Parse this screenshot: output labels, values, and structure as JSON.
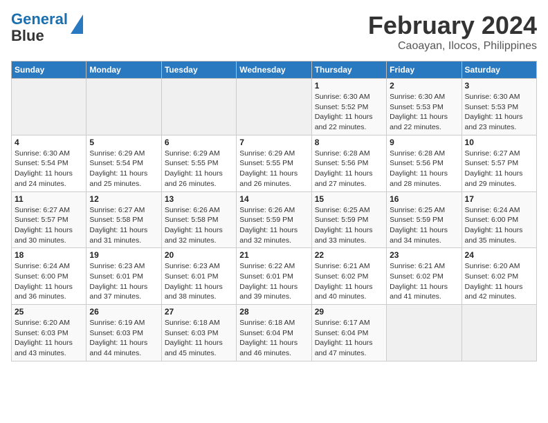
{
  "header": {
    "logo_line1": "General",
    "logo_line2": "Blue",
    "title": "February 2024",
    "subtitle": "Caoayan, Ilocos, Philippines"
  },
  "calendar": {
    "headers": [
      "Sunday",
      "Monday",
      "Tuesday",
      "Wednesday",
      "Thursday",
      "Friday",
      "Saturday"
    ],
    "weeks": [
      [
        {
          "day": "",
          "info": ""
        },
        {
          "day": "",
          "info": ""
        },
        {
          "day": "",
          "info": ""
        },
        {
          "day": "",
          "info": ""
        },
        {
          "day": "1",
          "info": "Sunrise: 6:30 AM\nSunset: 5:52 PM\nDaylight: 11 hours and 22 minutes."
        },
        {
          "day": "2",
          "info": "Sunrise: 6:30 AM\nSunset: 5:53 PM\nDaylight: 11 hours and 22 minutes."
        },
        {
          "day": "3",
          "info": "Sunrise: 6:30 AM\nSunset: 5:53 PM\nDaylight: 11 hours and 23 minutes."
        }
      ],
      [
        {
          "day": "4",
          "info": "Sunrise: 6:30 AM\nSunset: 5:54 PM\nDaylight: 11 hours and 24 minutes."
        },
        {
          "day": "5",
          "info": "Sunrise: 6:29 AM\nSunset: 5:54 PM\nDaylight: 11 hours and 25 minutes."
        },
        {
          "day": "6",
          "info": "Sunrise: 6:29 AM\nSunset: 5:55 PM\nDaylight: 11 hours and 26 minutes."
        },
        {
          "day": "7",
          "info": "Sunrise: 6:29 AM\nSunset: 5:55 PM\nDaylight: 11 hours and 26 minutes."
        },
        {
          "day": "8",
          "info": "Sunrise: 6:28 AM\nSunset: 5:56 PM\nDaylight: 11 hours and 27 minutes."
        },
        {
          "day": "9",
          "info": "Sunrise: 6:28 AM\nSunset: 5:56 PM\nDaylight: 11 hours and 28 minutes."
        },
        {
          "day": "10",
          "info": "Sunrise: 6:27 AM\nSunset: 5:57 PM\nDaylight: 11 hours and 29 minutes."
        }
      ],
      [
        {
          "day": "11",
          "info": "Sunrise: 6:27 AM\nSunset: 5:57 PM\nDaylight: 11 hours and 30 minutes."
        },
        {
          "day": "12",
          "info": "Sunrise: 6:27 AM\nSunset: 5:58 PM\nDaylight: 11 hours and 31 minutes."
        },
        {
          "day": "13",
          "info": "Sunrise: 6:26 AM\nSunset: 5:58 PM\nDaylight: 11 hours and 32 minutes."
        },
        {
          "day": "14",
          "info": "Sunrise: 6:26 AM\nSunset: 5:59 PM\nDaylight: 11 hours and 32 minutes."
        },
        {
          "day": "15",
          "info": "Sunrise: 6:25 AM\nSunset: 5:59 PM\nDaylight: 11 hours and 33 minutes."
        },
        {
          "day": "16",
          "info": "Sunrise: 6:25 AM\nSunset: 5:59 PM\nDaylight: 11 hours and 34 minutes."
        },
        {
          "day": "17",
          "info": "Sunrise: 6:24 AM\nSunset: 6:00 PM\nDaylight: 11 hours and 35 minutes."
        }
      ],
      [
        {
          "day": "18",
          "info": "Sunrise: 6:24 AM\nSunset: 6:00 PM\nDaylight: 11 hours and 36 minutes."
        },
        {
          "day": "19",
          "info": "Sunrise: 6:23 AM\nSunset: 6:01 PM\nDaylight: 11 hours and 37 minutes."
        },
        {
          "day": "20",
          "info": "Sunrise: 6:23 AM\nSunset: 6:01 PM\nDaylight: 11 hours and 38 minutes."
        },
        {
          "day": "21",
          "info": "Sunrise: 6:22 AM\nSunset: 6:01 PM\nDaylight: 11 hours and 39 minutes."
        },
        {
          "day": "22",
          "info": "Sunrise: 6:21 AM\nSunset: 6:02 PM\nDaylight: 11 hours and 40 minutes."
        },
        {
          "day": "23",
          "info": "Sunrise: 6:21 AM\nSunset: 6:02 PM\nDaylight: 11 hours and 41 minutes."
        },
        {
          "day": "24",
          "info": "Sunrise: 6:20 AM\nSunset: 6:02 PM\nDaylight: 11 hours and 42 minutes."
        }
      ],
      [
        {
          "day": "25",
          "info": "Sunrise: 6:20 AM\nSunset: 6:03 PM\nDaylight: 11 hours and 43 minutes."
        },
        {
          "day": "26",
          "info": "Sunrise: 6:19 AM\nSunset: 6:03 PM\nDaylight: 11 hours and 44 minutes."
        },
        {
          "day": "27",
          "info": "Sunrise: 6:18 AM\nSunset: 6:03 PM\nDaylight: 11 hours and 45 minutes."
        },
        {
          "day": "28",
          "info": "Sunrise: 6:18 AM\nSunset: 6:04 PM\nDaylight: 11 hours and 46 minutes."
        },
        {
          "day": "29",
          "info": "Sunrise: 6:17 AM\nSunset: 6:04 PM\nDaylight: 11 hours and 47 minutes."
        },
        {
          "day": "",
          "info": ""
        },
        {
          "day": "",
          "info": ""
        }
      ]
    ]
  }
}
